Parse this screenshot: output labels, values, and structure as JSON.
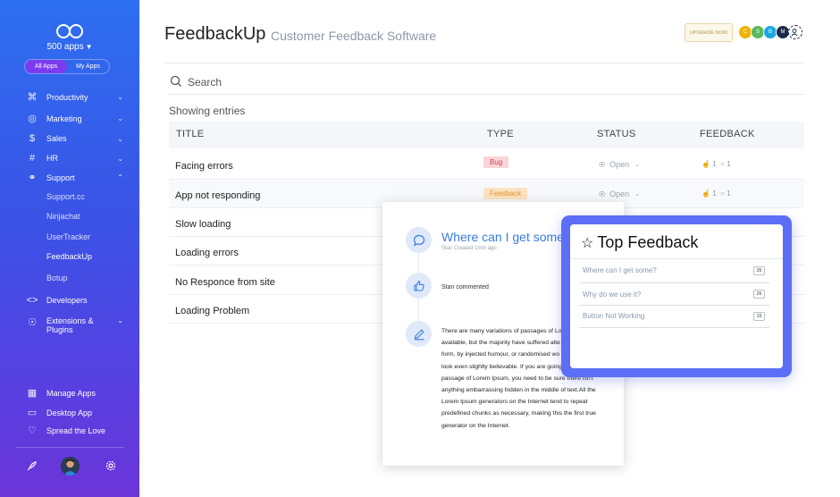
{
  "sidebar": {
    "apps_count": "500 apps",
    "segment": {
      "all": "All Apps",
      "mine": "My Apps"
    },
    "items": [
      {
        "label": "Productivity",
        "icon": "command-icon"
      },
      {
        "label": "Marketing",
        "icon": "target-icon"
      },
      {
        "label": "Sales",
        "icon": "dollar-icon"
      },
      {
        "label": "HR",
        "icon": "hash-icon"
      },
      {
        "label": "Support",
        "icon": "headset-icon"
      },
      {
        "label": "Developers",
        "icon": "code-icon"
      },
      {
        "label": "Extensions &",
        "label2": "Plugins",
        "icon": "globe-icon"
      }
    ],
    "support_sub": [
      "Support.cc",
      "Ninjachat",
      "UserTracker",
      "FeedbackUp",
      "Botup"
    ],
    "footer_links": [
      {
        "label": "Manage Apps",
        "icon": "grid-icon"
      },
      {
        "label": "Desktop App",
        "icon": "monitor-icon"
      },
      {
        "label": "Spread the Love",
        "icon": "heart-icon"
      }
    ]
  },
  "header": {
    "title": "FeedbackUp",
    "subtitle": "Customer Feedback Software",
    "upgrade": "UPGRADE NOW",
    "bubbles": [
      {
        "text": "C",
        "color": "#f0b400"
      },
      {
        "text": "S",
        "color": "#5cb85c"
      },
      {
        "text": "B",
        "color": "#1aa7e0"
      },
      {
        "text": "M",
        "color": "#1d2b4a"
      }
    ]
  },
  "search": {
    "placeholder": "Search"
  },
  "table": {
    "showing": "Showing entries",
    "columns": [
      "TITLE",
      "TYPE",
      "STATUS",
      "FEEDBACK"
    ],
    "rows": [
      {
        "title": "Facing errors",
        "type": "Bug",
        "status": "Open",
        "likes": "1",
        "comments": "1"
      },
      {
        "title": "App not responding",
        "type": "Feedback",
        "status": "Open",
        "likes": "1",
        "comments": "1"
      },
      {
        "title": "Slow loading"
      },
      {
        "title": "Loading errors"
      },
      {
        "title": "No Responce from site"
      },
      {
        "title": "Loading Problem"
      }
    ]
  },
  "colors": {
    "bug_bg": "#fbd5d9",
    "bug_fg": "#d9434f",
    "feedback_bg": "#fde3c1",
    "feedback_fg": "#e8952e",
    "accent": "#5b6ef5"
  },
  "detail": {
    "title": "Where can I get some",
    "meta": "Stan Created 1min ago",
    "comment": "Stan commented",
    "body_lines": [
      "There are many variations of passages of Lo",
      "available, but the majority have suffered alte",
      "form, by injected humour, or randomised wo",
      "look even slightly believable. If you are going",
      "passage of Lorem Ipsum, you need to be sure there isn't",
      "anything embarrassing hidden in the middle of text.All the",
      "Lorem Ipsum generators on the Internet tend to repeat",
      "predefined chunks as necessary, making this the first true",
      "generator on the Internet."
    ]
  },
  "top_feedback": {
    "title": "Top Feedback",
    "items": [
      {
        "label": "Where can I get some?",
        "count": "35"
      },
      {
        "label": "Why do we use it?",
        "count": "26"
      },
      {
        "label": "Button Not Working",
        "count": "15"
      }
    ]
  }
}
